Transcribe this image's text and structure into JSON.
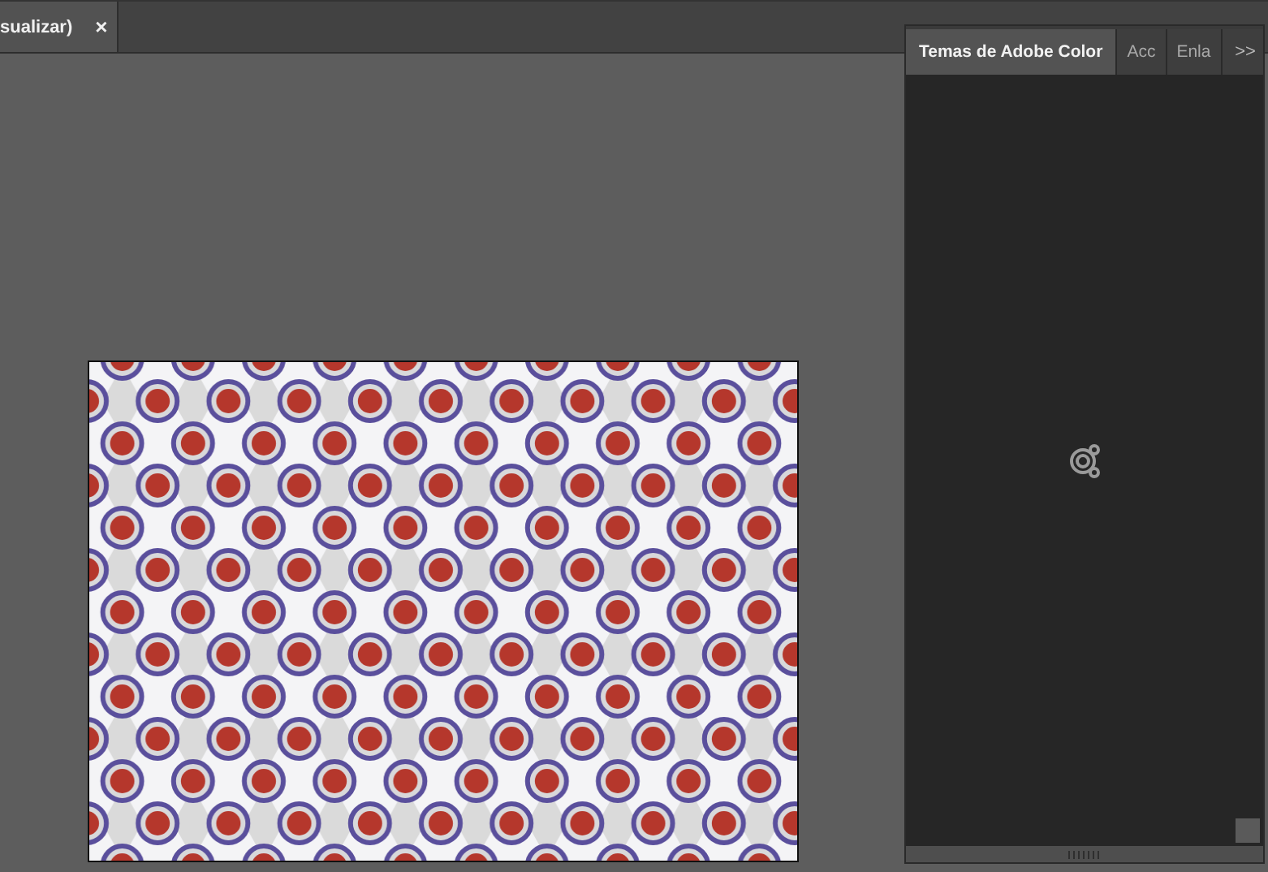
{
  "document_tab": {
    "label": "sualizar)",
    "close": "×"
  },
  "panel": {
    "tabs": [
      {
        "label": "Temas de Adobe Color",
        "selected": true
      },
      {
        "label": "Acc",
        "selected": false
      },
      {
        "label": "Enla",
        "selected": false
      }
    ],
    "overflow": ">>"
  }
}
